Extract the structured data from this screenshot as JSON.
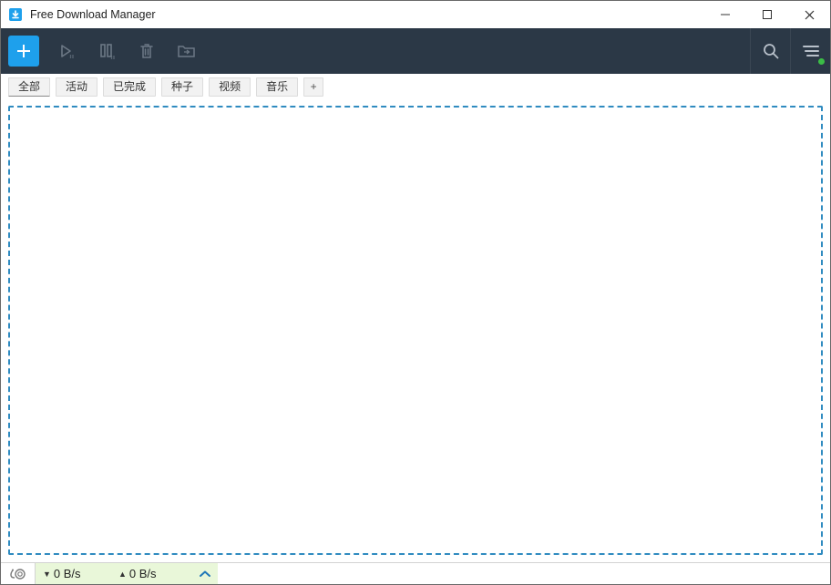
{
  "title": "Free Download Manager",
  "tabs": {
    "items": [
      {
        "label": "全部"
      },
      {
        "label": "活动"
      },
      {
        "label": "已完成"
      },
      {
        "label": "种子"
      },
      {
        "label": "视频"
      },
      {
        "label": "音乐"
      }
    ],
    "add_label": "+"
  },
  "status": {
    "download_speed": "0 B/s",
    "upload_speed": "0 B/s"
  }
}
